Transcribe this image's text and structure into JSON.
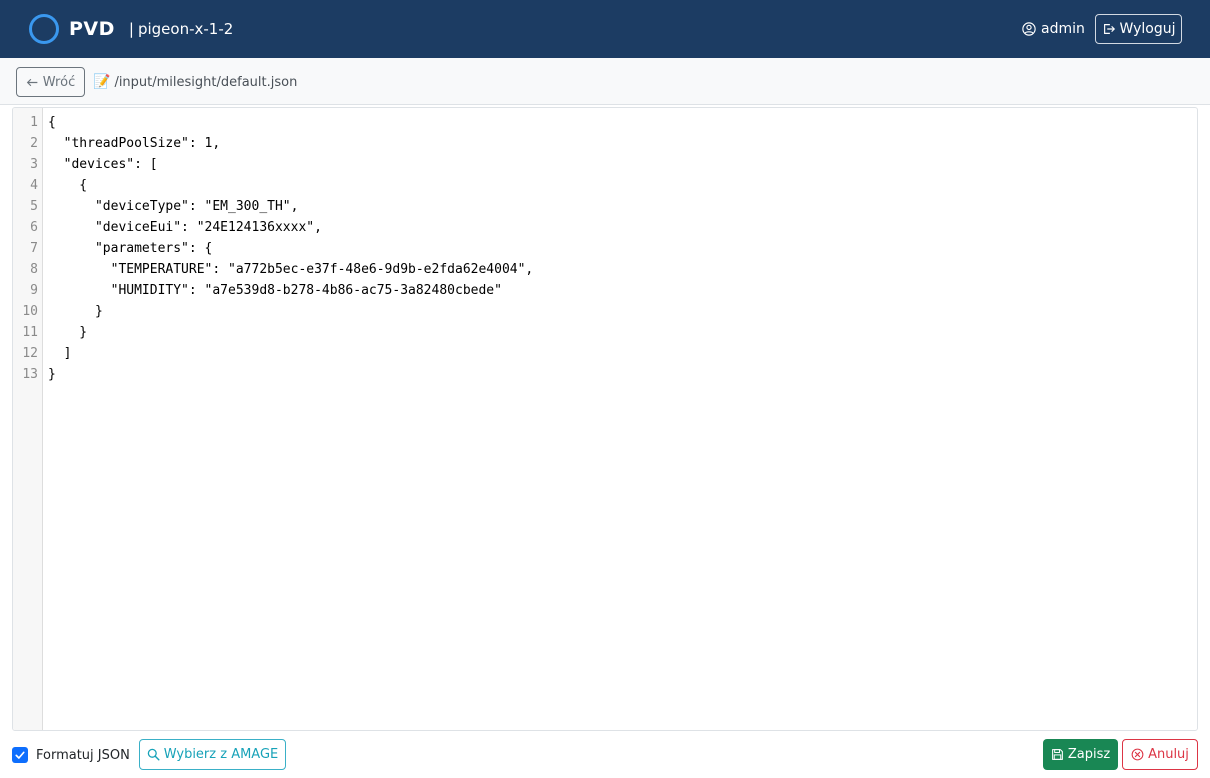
{
  "navbar": {
    "brand": "PVD",
    "separator": "|",
    "host": "pigeon-x-1-2",
    "user": "admin",
    "logout_label": "Wyloguj"
  },
  "toolbar": {
    "back_label": "Wróć",
    "file_icon": "memo-icon",
    "file_path": "/input/milesight/default.json"
  },
  "editor": {
    "line_numbers": [
      "1",
      "2",
      "3",
      "4",
      "5",
      "6",
      "7",
      "8",
      "9",
      "10",
      "11",
      "12",
      "13"
    ],
    "lines": [
      "{",
      "  \"threadPoolSize\": 1,",
      "  \"devices\": [",
      "    {",
      "      \"deviceType\": \"EM_300_TH\",",
      "      \"deviceEui\": \"24E124136xxxx\",",
      "      \"parameters\": {",
      "        \"TEMPERATURE\": \"a772b5ec-e37f-48e6-9d9b-e2fda62e4004\",",
      "        \"HUMIDITY\": \"a7e539d8-b278-4b86-ac75-3a82480cbede\"",
      "      }",
      "    }",
      "  ]",
      "}"
    ]
  },
  "footer": {
    "format_json_label": "Formatuj JSON",
    "format_json_checked": true,
    "amage_label": "Wybierz z AMAGE",
    "save_label": "Zapisz",
    "cancel_label": "Anuluj"
  },
  "colors": {
    "navbar_bg": "#1c3c63",
    "brand_ring": "#3a98ef",
    "save": "#198754",
    "cancel": "#dc3545",
    "info": "#17a2b8",
    "checkbox": "#0d6efd"
  }
}
